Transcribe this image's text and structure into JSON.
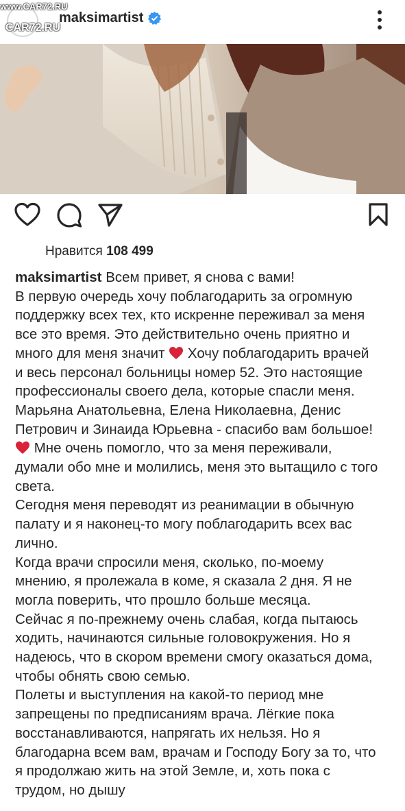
{
  "header": {
    "watermark_top": "www.CAR72.RU",
    "watermark_logo": "CAR72.RU",
    "username": "maksimartist"
  },
  "icons": {
    "verified": "verified-badge-icon",
    "more": "more-options-icon",
    "like": "heart-icon",
    "comment": "comment-icon",
    "share": "share-icon",
    "save": "bookmark-icon"
  },
  "colors": {
    "verified": "#3897f0",
    "text": "#262626",
    "heart": "#d8233a"
  },
  "likes": {
    "label": "Нравится",
    "count": "108 499"
  },
  "caption": {
    "username": "maksimartist",
    "lines": [
      "Всем привет, я снова с вами!",
      "В первую очередь хочу поблагодарить за огромную",
      "поддержку всех тех, кто искренне переживал за меня",
      "все это время. Это действительно очень приятно и",
      "много для меня значит",
      "Хочу поблагодарить врачей",
      "и весь персонал больницы номер 52. Это настоящие",
      "профессионалы своего дела, которые спасли меня.",
      "Марьяна Анатольевна, Елена Николаевна, Денис",
      "Петрович и Зинаида Юрьевна - спасибо вам большое!",
      "Мне очень помогло, что за меня переживали,",
      "думали обо мне и молились, меня это вытащило с того",
      "света.",
      "Сегодня меня переводят из реанимации в обычную",
      "палату и я наконец-то могу поблагодарить всех вас",
      "лично.",
      "Когда врачи спросили меня, сколько, по-моему",
      "мнению, я пролежала в коме, я сказала 2 дня. Я не",
      "могла поверить, что прошло больше месяца.",
      "Сейчас я по-прежнему очень слабая, когда пытаюсь",
      "ходить, начинаются сильные головокружения. Но я",
      "надеюсь, что в скором времени смогу оказаться дома,",
      "чтобы обнять свою семью.",
      "Полеты и выступления на какой-то период мне",
      "запрещены по предписаниям врача. Лёгкие пока",
      "восстанавливаются, напрягать их нельзя. Но я",
      "благодарна всем вам, врачам и Господу Богу за то, что",
      "я продолжаю жить на этой Земле, и, хоть пока с",
      "трудом, но дышу"
    ]
  }
}
